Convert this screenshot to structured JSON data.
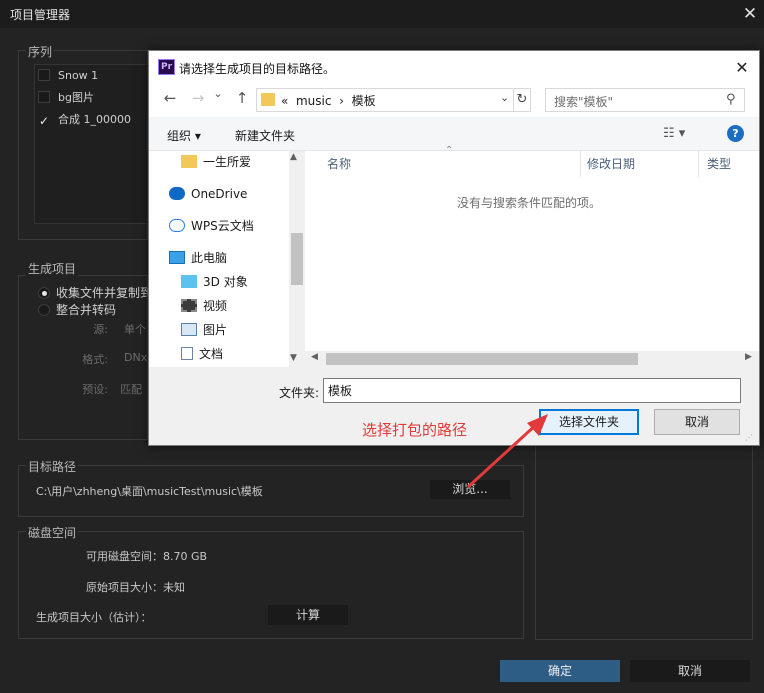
{
  "window": {
    "title": "项目管理器",
    "close_glyph": "✕"
  },
  "sequence": {
    "label": "序列",
    "items": [
      {
        "label": "Snow 1",
        "checked": false
      },
      {
        "label": "bg图片",
        "checked": false
      },
      {
        "label": "合成 1_00000",
        "checked": true
      }
    ]
  },
  "generate": {
    "label": "生成项目",
    "options": [
      {
        "label": "收集文件并复制到",
        "selected": true
      },
      {
        "label": "整合并转码",
        "selected": false
      }
    ],
    "source_label": "源:",
    "source_value": "单个",
    "format_label": "格式:",
    "format_value": "DNx",
    "preset_label": "预设:",
    "preset_value": "匹配"
  },
  "target": {
    "label": "目标路径",
    "path": "C:\\用户\\zhheng\\桌面\\musicTest\\music\\模板",
    "browse_button": "浏览..."
  },
  "disk": {
    "label": "磁盘空间",
    "available": "可用磁盘空间：8.70 GB",
    "original_size": "原始项目大小：未知",
    "generated_size_label": "生成项目大小（估计）：",
    "calculate_button": "计算"
  },
  "footer": {
    "ok_button": "确定",
    "cancel_button": "取消"
  },
  "dialog": {
    "title": "请选择生成项目的目标路径。",
    "app_icon": "Pr",
    "close_glyph": "✕",
    "nav": {
      "back": "←",
      "forward": "→",
      "dropdown": "⌄",
      "up": "↑"
    },
    "address": {
      "prefix": "«",
      "segments": [
        "music",
        "模板"
      ],
      "separator": "›",
      "refresh": "↻"
    },
    "search_placeholder": "搜索\"模板\"",
    "toolbar": {
      "organize": "组织 ▾",
      "new_folder": "新建文件夹",
      "view": "☷ ▾",
      "help": "?"
    },
    "tree": [
      {
        "label": "一生所爱",
        "icon": "folder-icon"
      },
      {
        "label": "OneDrive",
        "icon": "onedrive-icon"
      },
      {
        "label": "WPS云文档",
        "icon": "cloud-icon"
      },
      {
        "label": "此电脑",
        "icon": "computer-icon"
      },
      {
        "label": "3D 对象",
        "icon": "cube-icon"
      },
      {
        "label": "视频",
        "icon": "video-icon"
      },
      {
        "label": "图片",
        "icon": "picture-icon"
      },
      {
        "label": "文档",
        "icon": "document-icon"
      }
    ],
    "columns": [
      "名称",
      "修改日期",
      "类型"
    ],
    "empty_message": "没有与搜索条件匹配的项。",
    "folder_label": "文件夹:",
    "folder_value": "模板",
    "select_button": "选择文件夹",
    "cancel_button": "取消"
  },
  "annotation": {
    "text": "选择打包的路径",
    "color": "#e23a3a"
  },
  "colors": {
    "dark_bg": "#232323",
    "accent_blue": "#2d5c84",
    "dialog_focus": "#0078d7"
  }
}
